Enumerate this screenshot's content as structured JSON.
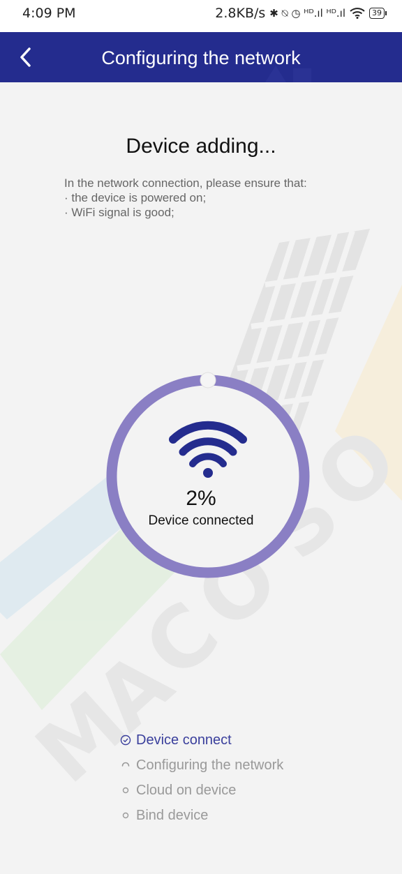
{
  "status_bar": {
    "time": "4:09 PM",
    "net_speed": "2.8KB/s",
    "indicators": "✱ ⍉ ◷ ᴴᴰ.ıl ᴴᴰ.ıl",
    "battery": "39"
  },
  "app_bar": {
    "title": "Configuring the network",
    "background_color": "#242c8e"
  },
  "main": {
    "heading": "Device adding...",
    "notice_intro": "In the network connection, please ensure that:",
    "notice_items": [
      "· the device is powered on;",
      "· WiFi signal is good;"
    ]
  },
  "progress": {
    "percent_text": "2%",
    "percent_value": 2,
    "label": "Device connected",
    "ring_color": "#8a7fc4",
    "icon": "wifi-icon"
  },
  "steps": [
    {
      "label": "Device connect",
      "state": "done",
      "icon": "check-circle-icon"
    },
    {
      "label": "Configuring the network",
      "state": "in-progress",
      "icon": "spinner-icon"
    },
    {
      "label": "Cloud on device",
      "state": "pending",
      "icon": "circle-icon"
    },
    {
      "label": "Bind device",
      "state": "pending",
      "icon": "circle-icon"
    }
  ],
  "watermark_text": "MACO SOL"
}
